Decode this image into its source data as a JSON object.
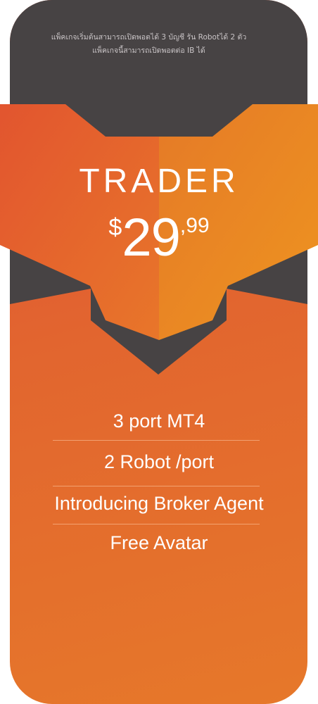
{
  "package": {
    "note_lines": [
      "แพ็คเกจเริ่มต้นสามารถเปิดพอตได้ 3 บัญชี รัน Robotได้ 2 ตัว",
      "แพ็คเกจนี้สามารถเปิดพอตต่อ IB ได้"
    ],
    "tier_name": "TRADER",
    "price": {
      "currency": "$",
      "amount": "29",
      "cents": ",99"
    },
    "features": [
      "3 port MT4",
      "2 Robot /port",
      "Introducing Broker Agent",
      "Free Avatar"
    ]
  },
  "colors": {
    "dark_panel": "#474344",
    "banner_left": "#e2552f",
    "banner_right": "#ec8f22",
    "card_body": "#e2652f",
    "text": "#ffffff"
  }
}
